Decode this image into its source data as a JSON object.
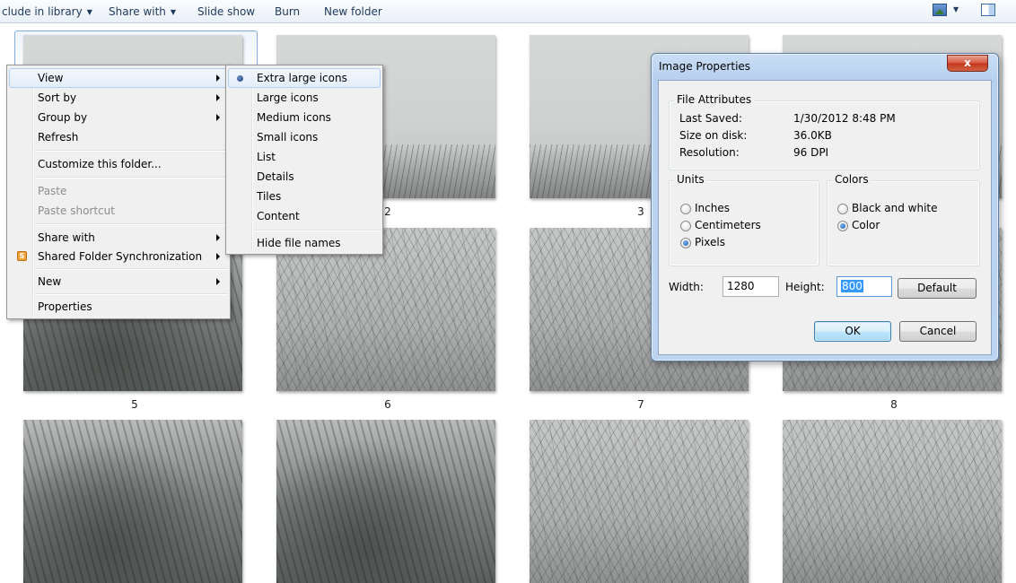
{
  "toolbar": {
    "include_label": "clude in library",
    "share_label": "Share with",
    "slideshow_label": "Slide show",
    "burn_label": "Burn",
    "newfolder_label": "New folder"
  },
  "thumbnails": {
    "row1": [
      "2",
      "3"
    ],
    "row2": [
      "5",
      "6",
      "7",
      "8"
    ]
  },
  "context_menu": {
    "view": "View",
    "sort_by": "Sort by",
    "group_by": "Group by",
    "refresh": "Refresh",
    "customize": "Customize this folder...",
    "paste": "Paste",
    "paste_shortcut": "Paste shortcut",
    "share_with": "Share with",
    "shared_sync": "Shared Folder Synchronization",
    "new": "New",
    "properties": "Properties"
  },
  "view_submenu": {
    "extra_large": "Extra large icons",
    "large": "Large icons",
    "medium": "Medium icons",
    "small": "Small icons",
    "list": "List",
    "details": "Details",
    "tiles": "Tiles",
    "content": "Content",
    "hide_names": "Hide file names",
    "selected": "Extra large icons"
  },
  "dialog": {
    "title": "Image Properties",
    "close_glyph": "x",
    "file_attributes": {
      "title": "File Attributes",
      "last_saved_label": "Last Saved:",
      "last_saved_value": "1/30/2012 8:48 PM",
      "size_label": "Size on disk:",
      "size_value": "36.0KB",
      "resolution_label": "Resolution:",
      "resolution_value": "96 DPI"
    },
    "units": {
      "title": "Units",
      "inches": "Inches",
      "centimeters": "Centimeters",
      "pixels": "Pixels",
      "selected": "Pixels"
    },
    "colors": {
      "title": "Colors",
      "bw": "Black and white",
      "color": "Color",
      "selected": "Color"
    },
    "width_label": "Width:",
    "width_value": "1280",
    "height_label": "Height:",
    "height_value": "800",
    "default_button": "Default",
    "ok_button": "OK",
    "cancel_button": "Cancel"
  },
  "colors": {
    "accent_highlight": "#aecff7",
    "close_button": "#c2361d",
    "selection": "#3399ff"
  }
}
